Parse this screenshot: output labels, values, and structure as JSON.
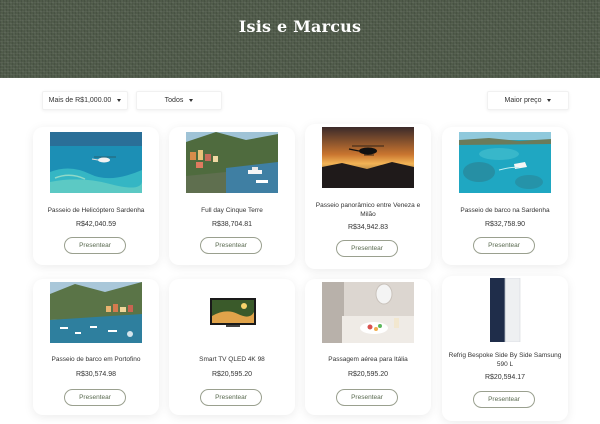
{
  "header": {
    "title": "Isis e Marcus"
  },
  "filters": {
    "price": "Mais de R$1,000.00",
    "category": "Todos",
    "sort": "Maior preço"
  },
  "products": [
    {
      "name": "Passeio de Helicóptero Sardenha",
      "price": "R$42,040.59",
      "button": "Presentear",
      "image": "helicopter-over-sea"
    },
    {
      "name": "Full day Cinque Terre",
      "price": "R$38,704.81",
      "button": "Presentear",
      "image": "cinque-terre-harbor"
    },
    {
      "name": "Passeio panorâmico entre Veneza e Milão",
      "price": "R$34,942.83",
      "button": "Presentear",
      "image": "helicopter-sunset"
    },
    {
      "name": "Passeio de barco na Sardenha",
      "price": "R$32,758.90",
      "button": "Presentear",
      "image": "boat-turquoise-sea"
    },
    {
      "name": "Passeio de barco em Portofino",
      "price": "R$30,574.98",
      "button": "Presentear",
      "image": "portofino-bay"
    },
    {
      "name": "Smart TV QLED 4K 98",
      "price": "R$20,595.20",
      "button": "Presentear",
      "image": "smart-tv"
    },
    {
      "name": "Passagem aérea para Itália",
      "price": "R$20,595.20",
      "button": "Presentear",
      "image": "airplane-meal"
    },
    {
      "name": "Refrig Bespoke Side By Side Samsung 590 L",
      "price": "R$20,594.17",
      "button": "Presentear",
      "image": "refrigerator"
    }
  ]
}
